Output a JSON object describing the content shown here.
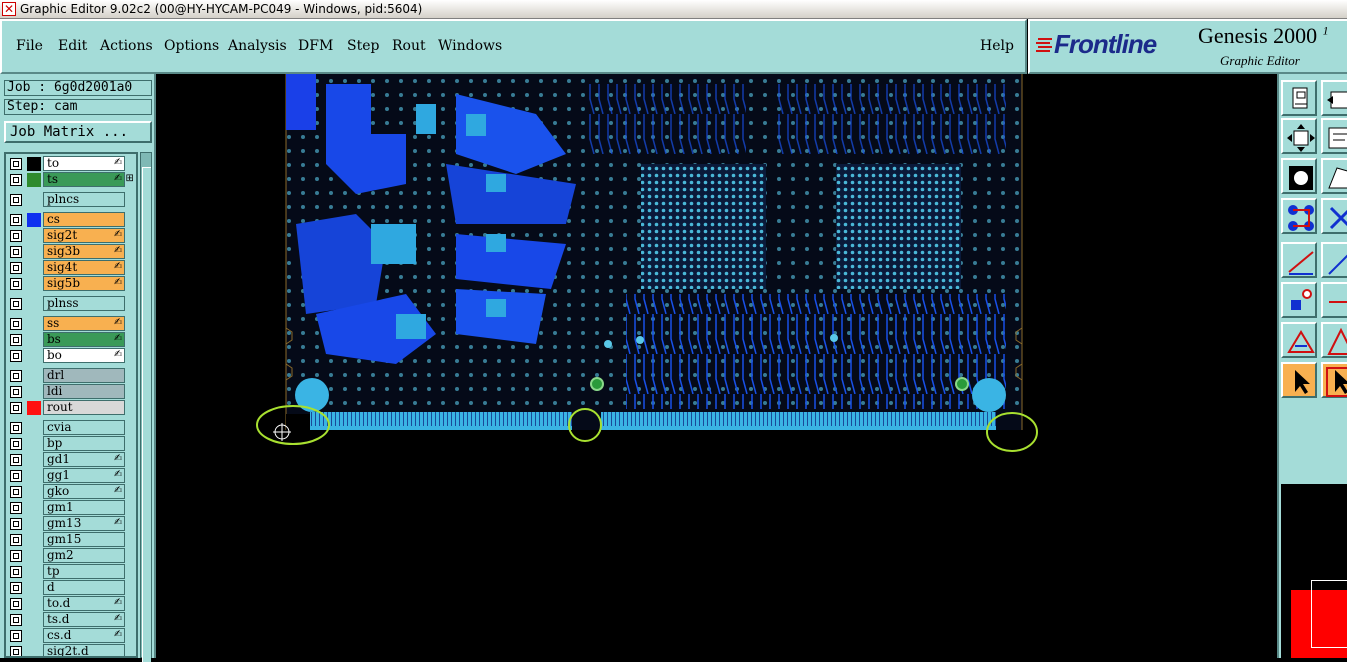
{
  "window": {
    "title": "Graphic Editor 9.02c2 (00@HY-HYCAM-PC049 - Windows, pid:5604)"
  },
  "menu": {
    "items": [
      "File",
      "Edit",
      "Actions",
      "Options",
      "Analysis",
      "DFM",
      "Step",
      "Rout",
      "Windows"
    ],
    "help": "Help"
  },
  "brand": {
    "logo": "Frontline",
    "product": "Genesis 2000",
    "product_suffix": "1",
    "subtitle": "Graphic Editor"
  },
  "job": {
    "label": "Job : 6g0d2001a0",
    "step": "Step: cam",
    "matrix_button": "Job Matrix ..."
  },
  "layers": [
    {
      "name": "to",
      "color": "#ffffff",
      "swatch": "#000000",
      "flag": "✍"
    },
    {
      "name": "ts",
      "color": "#3a9a58",
      "swatch": "#2e8b2e",
      "flag": "✍ ⊞"
    },
    {
      "name": "plncs",
      "color": "#a4dcd8",
      "swatch": "",
      "flag": ""
    },
    {
      "name": "cs",
      "color": "#f8b050",
      "swatch": "#1030f0",
      "flag": ""
    },
    {
      "name": "sig2t",
      "color": "#f8b050",
      "swatch": "",
      "flag": "✍"
    },
    {
      "name": "sig3b",
      "color": "#f8b050",
      "swatch": "",
      "flag": "✍"
    },
    {
      "name": "sig4t",
      "color": "#f8b050",
      "swatch": "",
      "flag": "✍"
    },
    {
      "name": "sig5b",
      "color": "#f8b050",
      "swatch": "",
      "flag": "✍"
    },
    {
      "name": "plnss",
      "color": "#a4dcd8",
      "swatch": "",
      "flag": ""
    },
    {
      "name": "ss",
      "color": "#f8b050",
      "swatch": "",
      "flag": "✍"
    },
    {
      "name": "bs",
      "color": "#3a9a58",
      "swatch": "",
      "flag": "✍"
    },
    {
      "name": "bo",
      "color": "#ffffff",
      "swatch": "",
      "flag": "✍"
    },
    {
      "name": "drl",
      "color": "#a0b8bc",
      "swatch": "",
      "flag": ""
    },
    {
      "name": "ldi",
      "color": "#a0b8bc",
      "swatch": "",
      "flag": ""
    },
    {
      "name": "rout",
      "color": "#d8d8d8",
      "swatch": "#ff1010",
      "flag": ""
    },
    {
      "name": "cvia",
      "color": "#a4dcd8",
      "swatch": "",
      "flag": ""
    },
    {
      "name": "bp",
      "color": "#a4dcd8",
      "swatch": "",
      "flag": ""
    },
    {
      "name": "gd1",
      "color": "#a4dcd8",
      "swatch": "",
      "flag": "✍"
    },
    {
      "name": "gg1",
      "color": "#a4dcd8",
      "swatch": "",
      "flag": "✍"
    },
    {
      "name": "gko",
      "color": "#a4dcd8",
      "swatch": "",
      "flag": "✍"
    },
    {
      "name": "gm1",
      "color": "#a4dcd8",
      "swatch": "",
      "flag": ""
    },
    {
      "name": "gm13",
      "color": "#a4dcd8",
      "swatch": "",
      "flag": "✍"
    },
    {
      "name": "gm15",
      "color": "#a4dcd8",
      "swatch": "",
      "flag": ""
    },
    {
      "name": "gm2",
      "color": "#a4dcd8",
      "swatch": "",
      "flag": ""
    },
    {
      "name": "tp",
      "color": "#a4dcd8",
      "swatch": "",
      "flag": ""
    },
    {
      "name": "d",
      "color": "#a4dcd8",
      "swatch": "",
      "flag": ""
    },
    {
      "name": "to.d",
      "color": "#a4dcd8",
      "swatch": "",
      "flag": "✍"
    },
    {
      "name": "ts.d",
      "color": "#a4dcd8",
      "swatch": "",
      "flag": "✍"
    },
    {
      "name": "cs.d",
      "color": "#a4dcd8",
      "swatch": "",
      "flag": "✍"
    },
    {
      "name": "sig2t.d",
      "color": "#a4dcd8",
      "swatch": "",
      "flag": ""
    }
  ],
  "tools": [
    "paste-icon",
    "move-window-icon",
    "fit-screen-icon",
    "properties-icon",
    "snap-icon",
    "polygon-icon",
    "connect-icon",
    "cross-icon",
    "line-icon",
    "line-diag-icon",
    "select-red-icon",
    "line-red-icon",
    "triangle-icon",
    "triangle2-icon",
    "pointer-icon",
    "pointer-select-icon"
  ]
}
